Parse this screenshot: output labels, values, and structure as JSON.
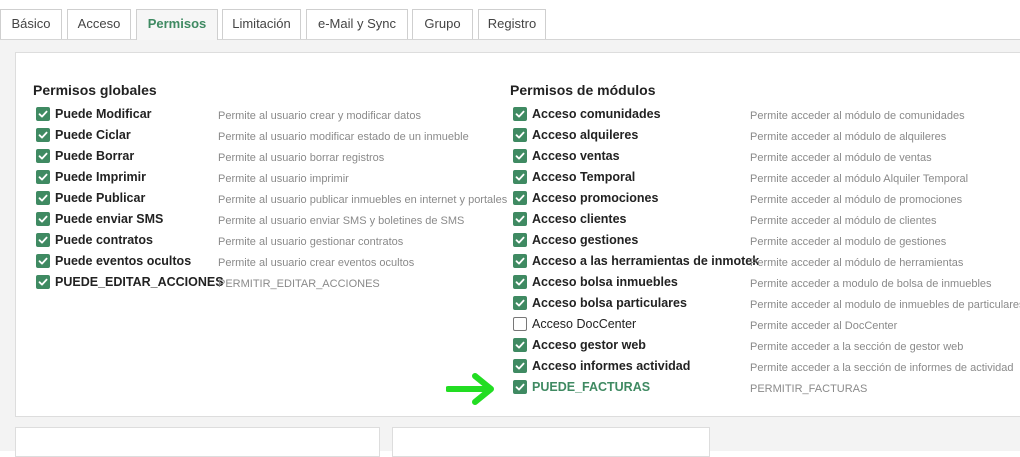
{
  "tabs": [
    {
      "label": "Básico",
      "active": false
    },
    {
      "label": "Acceso",
      "active": false
    },
    {
      "label": "Permisos",
      "active": true
    },
    {
      "label": "Limitación",
      "active": false
    },
    {
      "label": "e-Mail y Sync",
      "active": false
    },
    {
      "label": "Grupo",
      "active": false
    },
    {
      "label": "Registro",
      "active": false
    }
  ],
  "global_permissions": {
    "title": "Permisos globales",
    "items": [
      {
        "label": "Puede Modificar",
        "description": "Permite al usuario crear y modificar datos",
        "checked": true
      },
      {
        "label": "Puede Ciclar",
        "description": "Permite al usuario modificar estado de un inmueble",
        "checked": true
      },
      {
        "label": "Puede Borrar",
        "description": "Permite al usuario borrar registros",
        "checked": true
      },
      {
        "label": "Puede Imprimir",
        "description": "Permite al usuario imprimir",
        "checked": true
      },
      {
        "label": "Puede Publicar",
        "description": "Permite al usuario publicar inmuebles en internet y portales",
        "checked": true
      },
      {
        "label": "Puede enviar SMS",
        "description": "Permite al usuario enviar SMS y boletines de SMS",
        "checked": true
      },
      {
        "label": "Puede contratos",
        "description": "Permite al usuario gestionar contratos",
        "checked": true
      },
      {
        "label": "Puede eventos ocultos",
        "description": "Permite al usuario crear eventos ocultos",
        "checked": true
      },
      {
        "label": "PUEDE_EDITAR_ACCIONES",
        "description": "PERMITIR_EDITAR_ACCIONES",
        "checked": true
      }
    ]
  },
  "module_permissions": {
    "title": "Permisos de módulos",
    "items": [
      {
        "label": "Acceso comunidades",
        "description": "Permite acceder al módulo de comunidades",
        "checked": true
      },
      {
        "label": "Acceso alquileres",
        "description": "Permite acceder al módulo de alquileres",
        "checked": true
      },
      {
        "label": "Acceso ventas",
        "description": "Permite acceder al módulo de ventas",
        "checked": true
      },
      {
        "label": "Acceso Temporal",
        "description": "Permite acceder al módulo Alquiler Temporal",
        "checked": true
      },
      {
        "label": "Acceso promociones",
        "description": "Permite acceder al módulo de promociones",
        "checked": true
      },
      {
        "label": "Acceso clientes",
        "description": "Permite acceder al módulo de clientes",
        "checked": true
      },
      {
        "label": "Acceso gestiones",
        "description": "Permite acceder al modulo de gestiones",
        "checked": true
      },
      {
        "label": "Acceso a las herramientas de inmotek",
        "description": "Permite acceder al módulo de herramientas",
        "checked": true
      },
      {
        "label": "Acceso bolsa inmuebles",
        "description": "Permite acceder a modulo de bolsa de inmuebles",
        "checked": true
      },
      {
        "label": "Acceso bolsa particulares",
        "description": "Permite acceder al modulo de inmuebles de particulares",
        "checked": true
      },
      {
        "label": "Acceso DocCenter",
        "description": "Permite acceder al DocCenter",
        "checked": false
      },
      {
        "label": "Acceso gestor web",
        "description": "Permite acceder a la sección de gestor web",
        "checked": true
      },
      {
        "label": "Acceso informes actividad",
        "description": "Permite acceder a la sección de informes de actividad",
        "checked": true
      },
      {
        "label": "PUEDE_FACTURAS",
        "description": "PERMITIR_FACTURAS",
        "checked": true,
        "highlighted": true
      }
    ]
  },
  "colors": {
    "accent": "#3f8a62",
    "arrow": "#22dd22",
    "description_text": "#8a8a8a"
  },
  "icons": {
    "checkbox": "check-icon",
    "pointer": "arrow-right-icon"
  }
}
